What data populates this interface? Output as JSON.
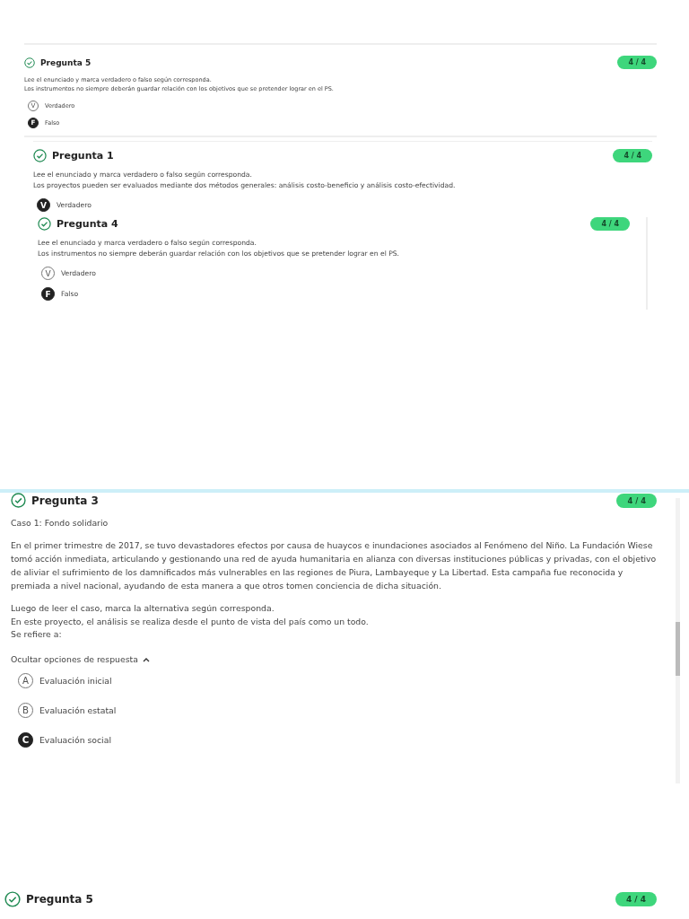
{
  "blocks": [
    {
      "title": "Pregunta 5",
      "score": "4 / 4",
      "paragraphs": [
        [
          "Lee el enunciado y marca verdadero o falso según corresponda.",
          "Los instrumentos no siempre deberán guardar relación con los objetivos que se pretender lograr en el PS."
        ]
      ],
      "options": [
        {
          "letter": "V",
          "label": "Verdadero",
          "selected": false
        },
        {
          "letter": "F",
          "label": "Falso",
          "selected": true
        }
      ]
    },
    {
      "title": "Pregunta 1",
      "score": "4 / 4",
      "paragraphs": [
        [
          "Lee el enunciado y marca verdadero o falso según corresponda.",
          "Los proyectos pueden ser evaluados mediante dos métodos generales: análisis costo-beneficio y análisis costo-efectividad."
        ]
      ],
      "options": [
        {
          "letter": "V",
          "label": "Verdadero",
          "selected": true
        }
      ]
    },
    {
      "title": "Pregunta 4",
      "score": "4 / 4",
      "paragraphs": [
        [
          "Lee el enunciado y marca verdadero o falso según corresponda.",
          "Los instrumentos no siempre deberán guardar relación con los objetivos que se pretender lograr en el PS."
        ]
      ],
      "options": [
        {
          "letter": "V",
          "label": "Verdadero",
          "selected": false
        },
        {
          "letter": "F",
          "label": "Falso",
          "selected": true
        }
      ]
    },
    {
      "title": "Pregunta 3",
      "score": "4 / 4",
      "paragraphs": [
        [
          "Caso 1: Fondo solidario"
        ],
        [
          "En el primer trimestre de 2017, se tuvo devastadores efectos por causa de huaycos e inundaciones asociados al Fenómeno del Niño. La Fundación Wiese tomó acción inmediata, articulando y gestionando una red de ayuda humanitaria en alianza con diversas instituciones públicas y privadas, con el objetivo de aliviar el sufrimiento de los damnificados más vulnerables en las regiones de Piura, Lambayeque y La Libertad. Esta campaña fue reconocida y premiada a nivel nacional, ayudando de esta manera a que otros tomen conciencia de dicha situación."
        ],
        [
          "Luego de leer el caso, marca la alternativa según corresponda.",
          "En este proyecto, el análisis se realiza desde el punto de vista del país como un todo.",
          "Se refiere a:"
        ]
      ],
      "toggle": {
        "label": "Ocultar opciones de respuesta",
        "expanded": true
      },
      "options": [
        {
          "letter": "A",
          "label": "Evaluación inicial",
          "selected": false
        },
        {
          "letter": "B",
          "label": "Evaluación estatal",
          "selected": false
        },
        {
          "letter": "C",
          "label": "Evaluación social",
          "selected": true
        }
      ]
    },
    {
      "title": "Pregunta 5",
      "score": "4 / 4"
    }
  ]
}
